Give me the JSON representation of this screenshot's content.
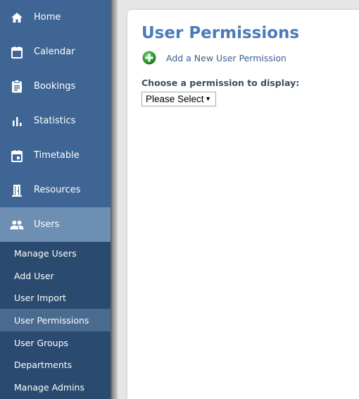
{
  "sidebar": {
    "items": [
      {
        "label": "Home",
        "icon": "home-icon"
      },
      {
        "label": "Calendar",
        "icon": "calendar-icon"
      },
      {
        "label": "Bookings",
        "icon": "clipboard-icon"
      },
      {
        "label": "Statistics",
        "icon": "bar-chart-icon"
      },
      {
        "label": "Timetable",
        "icon": "event-icon"
      },
      {
        "label": "Resources",
        "icon": "door-icon"
      },
      {
        "label": "Users",
        "icon": "people-icon",
        "active": true
      }
    ],
    "subitems": [
      {
        "label": "Manage Users"
      },
      {
        "label": "Add User"
      },
      {
        "label": "User Import"
      },
      {
        "label": "User Permissions",
        "active": true
      },
      {
        "label": "User Groups"
      },
      {
        "label": "Departments"
      },
      {
        "label": "Manage Admins"
      }
    ]
  },
  "main": {
    "title": "User Permissions",
    "add_link": {
      "label": "Add a New User Permission",
      "icon": "add-circle-icon"
    },
    "choose_label": "Choose a permission to display:",
    "select": {
      "value": "Please Select"
    }
  },
  "colors": {
    "sidebar": "#3e6594",
    "sidebar_active": "#6e8fb4",
    "subnav": "#2b4a6f",
    "subnav_active": "#4a6a8f",
    "title": "#4a7ab9",
    "add_icon": "#3aa53a"
  }
}
